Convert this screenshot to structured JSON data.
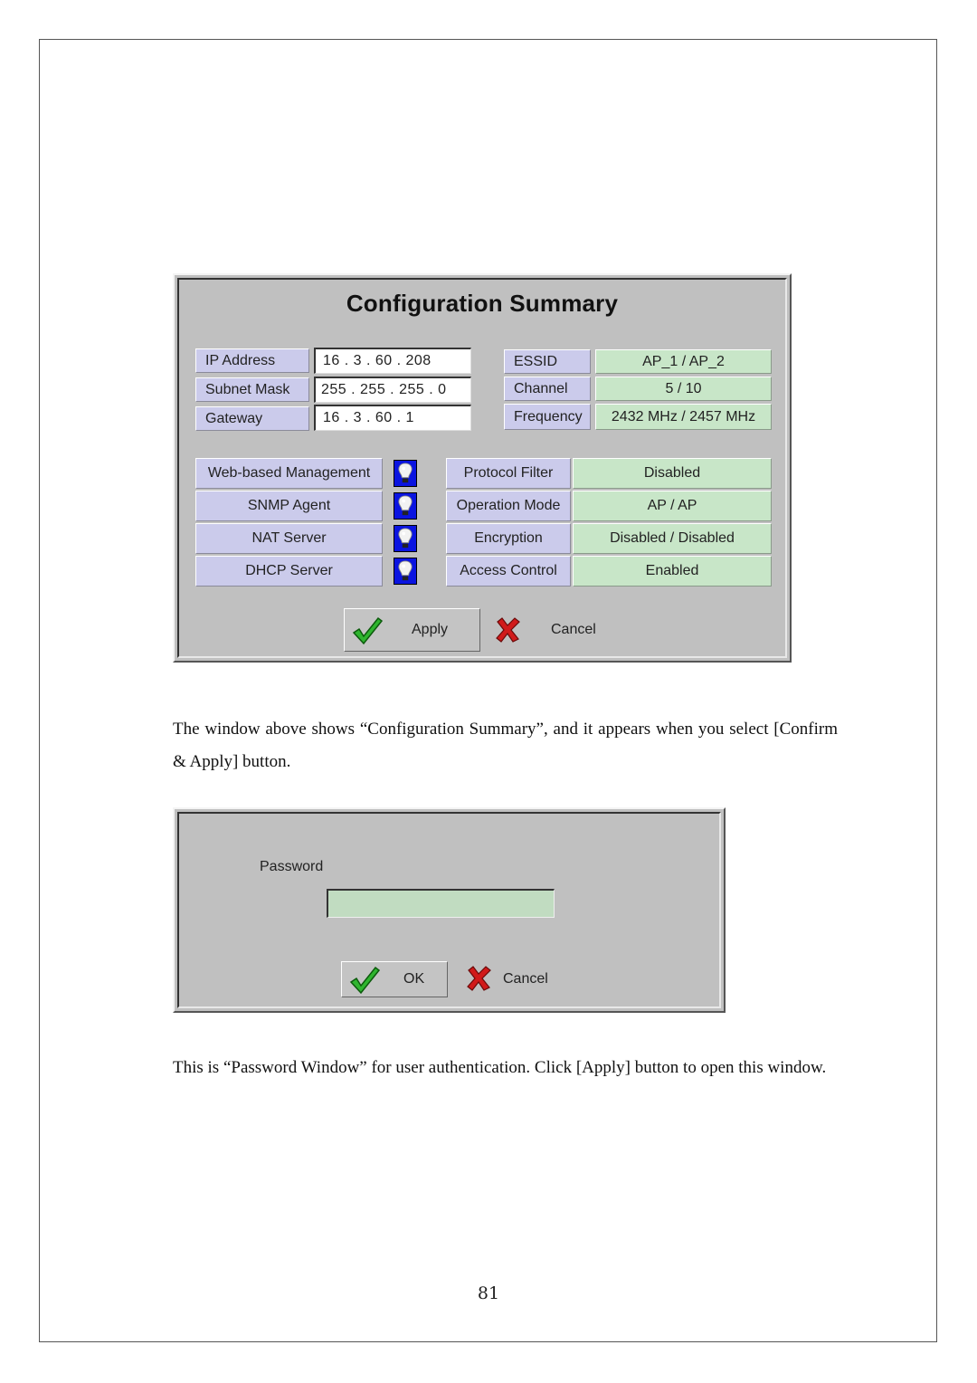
{
  "config_window": {
    "title": "Configuration Summary",
    "network": [
      {
        "label": "IP Address",
        "value": "16  .  3  . 60  . 208"
      },
      {
        "label": "Subnet Mask",
        "value": "255 . 255 . 255 .  0"
      },
      {
        "label": "Gateway",
        "value": "16  .  3  . 60  .  1"
      }
    ],
    "wireless": [
      {
        "label": "ESSID",
        "value": "AP_1 / AP_2"
      },
      {
        "label": "Channel",
        "value": "5 / 10"
      },
      {
        "label": "Frequency",
        "value": "2432 MHz / 2457 MHz"
      }
    ],
    "services": [
      {
        "label": "Web-based Management",
        "icon": "lightbulb-icon"
      },
      {
        "label": "SNMP Agent",
        "icon": "lightbulb-icon"
      },
      {
        "label": "NAT Server",
        "icon": "lightbulb-icon"
      },
      {
        "label": "DHCP Server",
        "icon": "lightbulb-icon"
      }
    ],
    "settings": [
      {
        "label": "Protocol Filter",
        "value": "Disabled"
      },
      {
        "label": "Operation Mode",
        "value": "AP / AP"
      },
      {
        "label": "Encryption",
        "value": "Disabled / Disabled"
      },
      {
        "label": "Access Control",
        "value": "Enabled"
      }
    ],
    "apply_label": "Apply",
    "cancel_label": "Cancel"
  },
  "paragraph1": "The window above shows “Configuration Summary”, and it appears when you select [Confirm & Apply] button.",
  "password_window": {
    "label": "Password",
    "value": "",
    "ok_label": "OK",
    "cancel_label": "Cancel"
  },
  "paragraph2": "This is “Password Window” for user authentication. Click [Apply] button to open this window.",
  "page_number": "81",
  "colors": {
    "label_bg": "#cbcbeb",
    "value_green": "#c8e6c8",
    "window_bg": "#c0c0c0",
    "bulb_bg": "#0a14e0"
  }
}
